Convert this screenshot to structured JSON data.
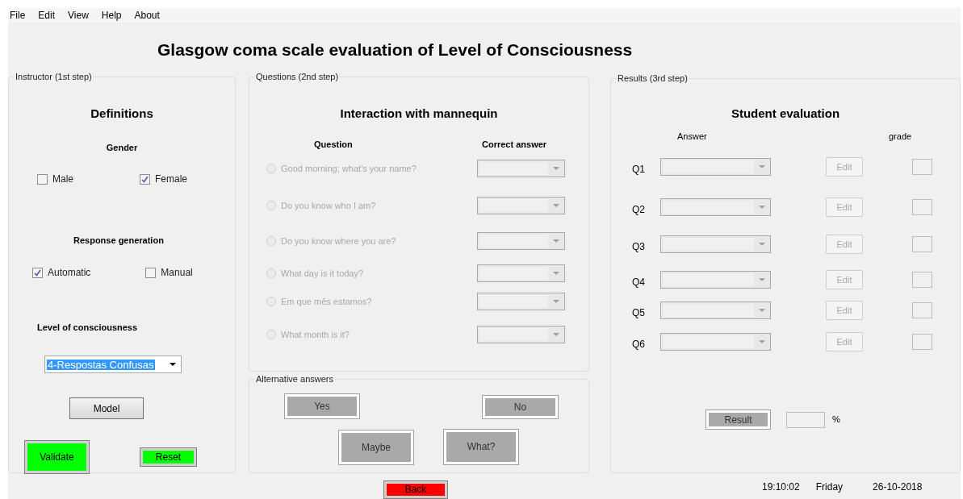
{
  "menu": [
    "File",
    "Edit",
    "View",
    "Help",
    "About"
  ],
  "title": "Glasgow coma scale evaluation of Level of Consciousness",
  "instructor": {
    "legend": "Instructor (1st step)",
    "heading": "Definitions",
    "gender": {
      "label": "Gender",
      "options": [
        {
          "label": "Male",
          "checked": false
        },
        {
          "label": "Female",
          "checked": true
        }
      ]
    },
    "response": {
      "label": "Response generation",
      "options": [
        {
          "label": "Automatic",
          "checked": true
        },
        {
          "label": "Manual",
          "checked": false
        }
      ]
    },
    "level": {
      "label": "Level of consciousness",
      "value": "4-Respostas Confusas"
    },
    "buttons": [
      {
        "label": "Model",
        "kind": "plain"
      },
      {
        "label": "Validate",
        "kind": "go"
      },
      {
        "label": "Reset",
        "kind": "go"
      }
    ]
  },
  "questions": {
    "legend": "Questions (2nd step)",
    "heading": "Interaction with mannequin",
    "columns": [
      "Question",
      "Correct answer"
    ],
    "rows": [
      {
        "text": "Good morning; what's your name?",
        "selected": false,
        "disabled": true
      },
      {
        "text": "Do you know who I am?",
        "selected": false,
        "disabled": true
      },
      {
        "text": "Do you know where you are?",
        "selected": false,
        "disabled": true
      },
      {
        "text": "What day is it today?",
        "selected": false,
        "disabled": true
      },
      {
        "text": "Em que mês estamos?",
        "selected": false,
        "disabled": true
      },
      {
        "text": "What month is it?",
        "selected": false,
        "disabled": true
      }
    ]
  },
  "alternatives": {
    "legend": "Alternative answers",
    "buttons": [
      {
        "label": "Yes",
        "kind": "option"
      },
      {
        "label": "No",
        "kind": "option"
      },
      {
        "label": "Maybe",
        "kind": "option"
      },
      {
        "label": "What?",
        "kind": "option"
      }
    ]
  },
  "results": {
    "legend": "Results (3rd step)",
    "heading": "Student evaluation",
    "columns": [
      "Answer",
      "grade"
    ],
    "rows": [
      {
        "label": "Q1",
        "edit": "Edit",
        "disabled": true
      },
      {
        "label": "Q2",
        "edit": "Edit",
        "disabled": true
      },
      {
        "label": "Q3",
        "edit": "Edit",
        "disabled": true
      },
      {
        "label": "Q4",
        "edit": "Edit",
        "disabled": true
      },
      {
        "label": "Q5",
        "edit": "Edit",
        "disabled": true
      },
      {
        "label": "Q6",
        "edit": "Edit",
        "disabled": true
      }
    ],
    "result_button": {
      "label": "Result",
      "kind": "option"
    },
    "unit": "%"
  },
  "back_button": {
    "label": "Back",
    "kind": "stop"
  },
  "status": {
    "time": "19:10:02",
    "day": "Friday",
    "date": "26-10-2018"
  }
}
